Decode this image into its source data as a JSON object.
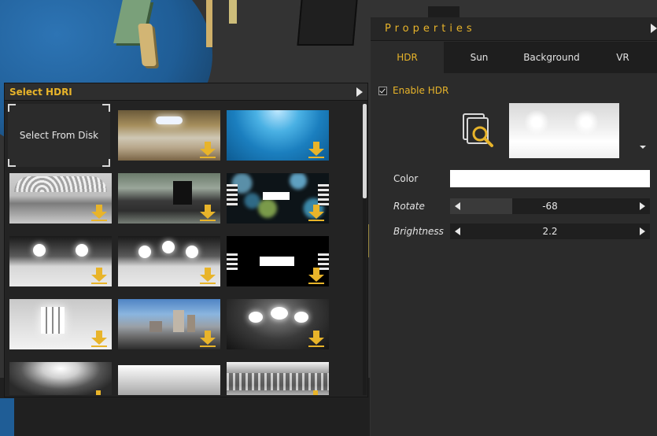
{
  "hdri_panel": {
    "title": "Select HDRI",
    "select_from_disk": "Select From Disk",
    "tiles": [
      {
        "icon": "download-icon"
      },
      {
        "icon": "download-icon"
      },
      {
        "icon": "download-icon"
      },
      {
        "icon": "download-icon"
      },
      {
        "icon": "download-icon"
      },
      {
        "icon": "download-icon"
      },
      {
        "icon": "download-icon"
      },
      {
        "icon": "download-icon"
      },
      {
        "icon": "download-icon"
      },
      {
        "icon": "download-icon"
      },
      {
        "icon": "download-icon"
      },
      {
        "icon": "download-icon"
      },
      {
        "icon": "download-icon"
      },
      {
        "icon": "download-icon"
      }
    ]
  },
  "properties": {
    "title": "Properties",
    "tabs": [
      {
        "label": "HDR",
        "active": true
      },
      {
        "label": "Sun",
        "active": false
      },
      {
        "label": "Background",
        "active": false
      },
      {
        "label": "VR",
        "active": false
      }
    ],
    "enable_hdr": {
      "label": "Enable HDR",
      "checked": true
    },
    "color": {
      "label": "Color",
      "value": "#ffffff"
    },
    "rotate": {
      "label": "Rotate",
      "value": "-68",
      "fraction": 0.31
    },
    "brightness": {
      "label": "Brightness",
      "value": "2.2",
      "fraction": 0.0
    }
  },
  "colors": {
    "accent": "#e8b42a",
    "panel_bg": "#2b2b2b",
    "header_bg": "#1e1e1e"
  }
}
